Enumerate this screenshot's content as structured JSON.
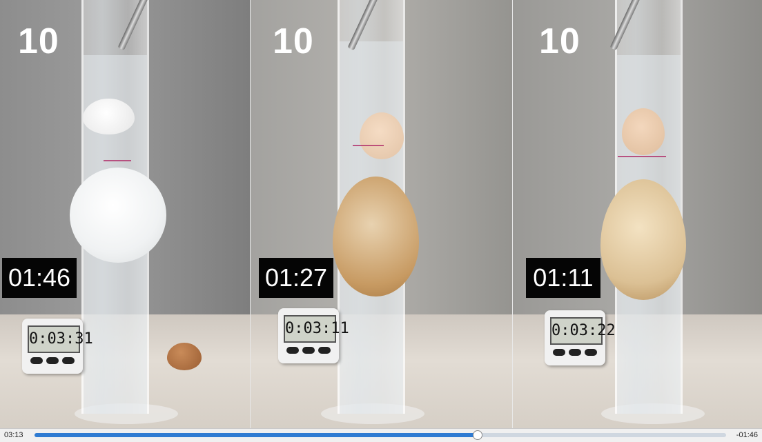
{
  "panels": [
    {
      "count": "10",
      "time": "01:46",
      "timer_display": "0:03:31"
    },
    {
      "count": "10",
      "time": "01:27",
      "timer_display": "0:03:11"
    },
    {
      "count": "10",
      "time": "01:11",
      "timer_display": "0:03:22"
    }
  ],
  "player": {
    "elapsed": "03:13",
    "remaining": "-01:46",
    "progress": 0.64
  },
  "colors": {
    "progress_fill": "#2f7bd2",
    "egg_shell_white": "#f3f5f6",
    "egg_shell_brown": "#c79a62"
  }
}
